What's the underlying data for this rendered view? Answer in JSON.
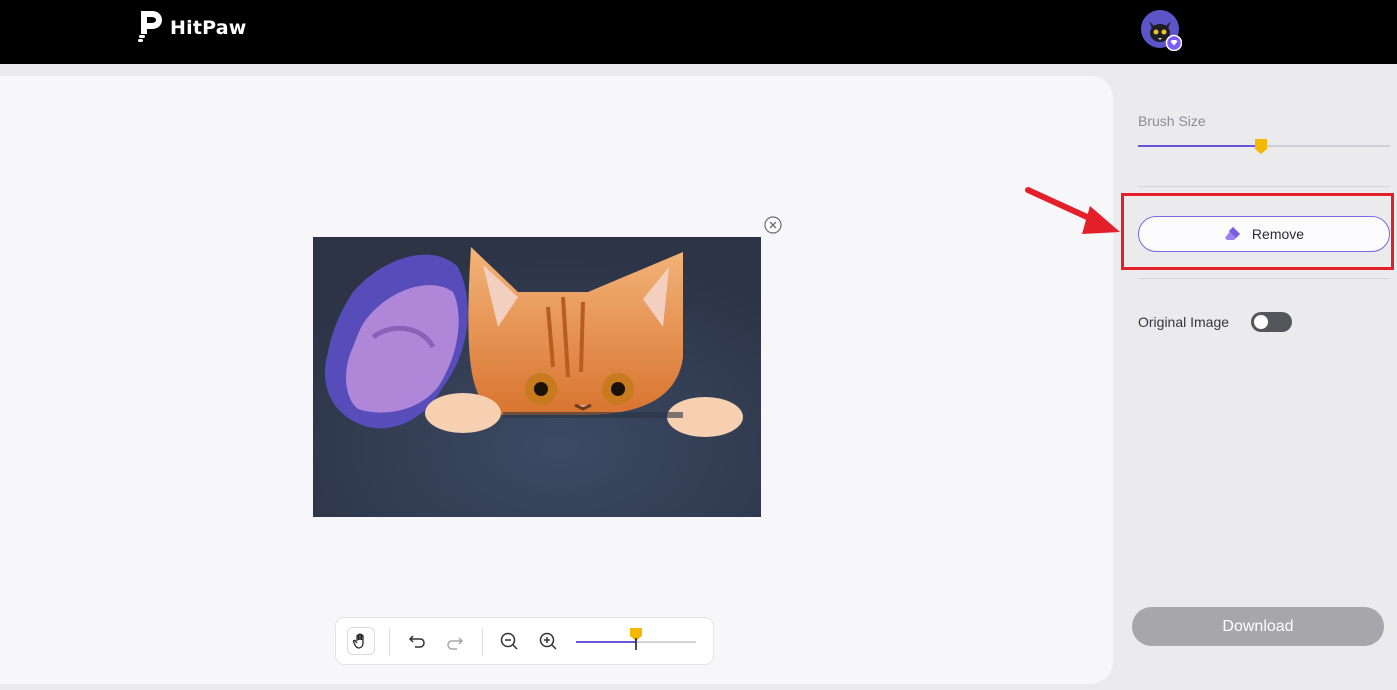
{
  "app": {
    "brand": "HitPaw"
  },
  "header": {
    "avatar_icon": "cat-avatar-icon"
  },
  "canvas": {
    "image_subject": "cat-peeking-image",
    "close_icon": "close-circle-icon",
    "toolbar": {
      "hand_icon": "hand-pan-icon",
      "undo_icon": "undo-icon",
      "redo_icon": "redo-icon",
      "zoom_out_icon": "zoom-out-icon",
      "zoom_in_icon": "zoom-in-icon",
      "zoom_level": 0.5
    }
  },
  "sidebar": {
    "brush_size_label": "Brush Size",
    "brush_size_level": 0.49,
    "remove_label": "Remove",
    "original_image_label": "Original Image",
    "original_image_on": false,
    "download_label": "Download"
  },
  "colors": {
    "accent": "#6b54d6",
    "thumb": "#f5b800",
    "highlight": "#e3202a",
    "download_disabled": "#a6a6ab"
  }
}
